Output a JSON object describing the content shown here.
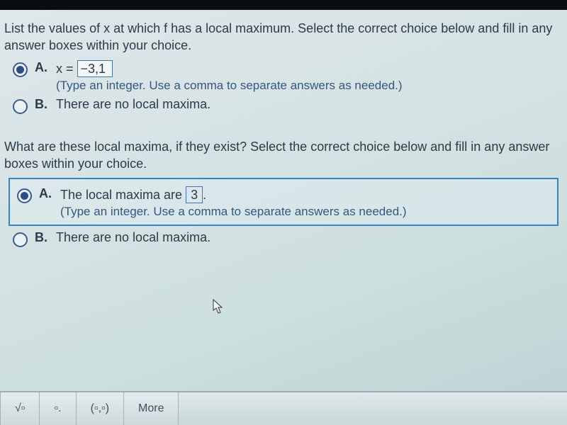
{
  "question1": {
    "prompt": "List the values of x at which f has a local maximum. Select the correct choice below and fill in any answer boxes within your choice.",
    "optionA": {
      "letter": "A.",
      "prefix": "x = ",
      "value": "−3,1",
      "hint": "(Type an integer. Use a comma to separate answers as needed.)"
    },
    "optionB": {
      "letter": "B.",
      "text": "There are no local maxima."
    }
  },
  "question2": {
    "prompt": "What are these local maxima, if they exist? Select the correct choice below and fill in any answer boxes within your choice.",
    "optionA": {
      "letter": "A.",
      "prefix": "The local maxima are ",
      "value": "3",
      "suffix": ".",
      "hint": "(Type an integer. Use a comma to separate answers as needed.)"
    },
    "optionB": {
      "letter": "B.",
      "text": "There are no local maxima."
    }
  },
  "toolbar": {
    "btn1": "√▫",
    "btn2": "▫.",
    "btn3": "(▫,▫)",
    "btn4": "More"
  }
}
